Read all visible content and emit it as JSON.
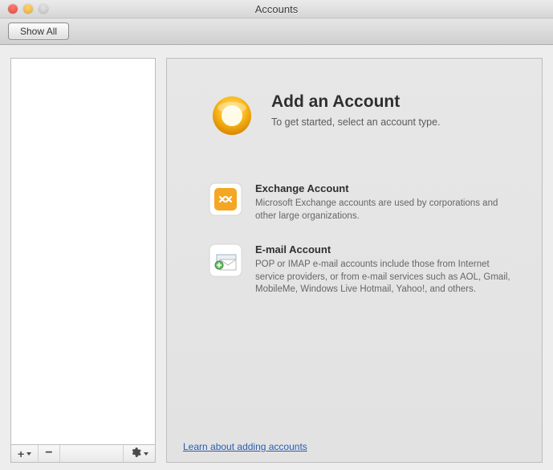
{
  "window": {
    "title": "Accounts"
  },
  "toolbar": {
    "show_all": "Show All"
  },
  "pane": {
    "title": "Add an Account",
    "subtitle": "To get started, select an account type.",
    "options": {
      "exchange": {
        "title": "Exchange Account",
        "desc": "Microsoft Exchange accounts are used by corporations and other large organizations."
      },
      "email": {
        "title": "E-mail Account",
        "desc": "POP or IMAP e-mail accounts include those from Internet service providers, or from e-mail services such as AOL, Gmail, MobileMe, Windows Live Hotmail, Yahoo!, and others."
      }
    },
    "learn_link": "Learn about adding accounts"
  },
  "footer": {
    "add_symbol": "+",
    "remove_symbol": "−"
  }
}
